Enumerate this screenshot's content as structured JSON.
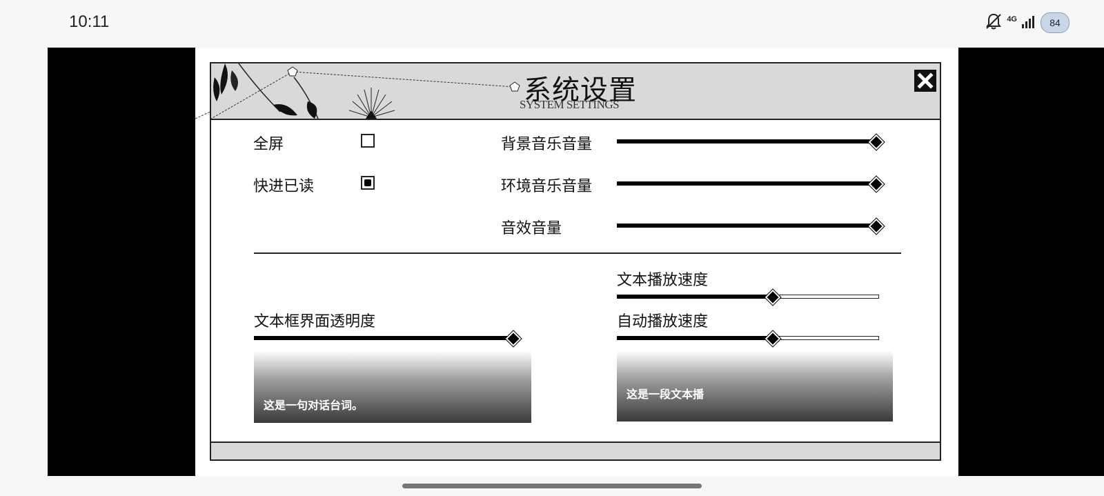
{
  "status_bar": {
    "time": "10:11",
    "network": "4G",
    "battery": "84",
    "icons": [
      "bell-muted-icon",
      "signal-icon",
      "battery-icon"
    ]
  },
  "dialog": {
    "title_zh": "系统设置",
    "title_en": "SYSTEM SETTINGS",
    "close_icon": "close-icon",
    "fullscreen": {
      "label": "全屏",
      "checked": false
    },
    "skip_read": {
      "label": "快进已读",
      "checked": true
    },
    "bgm_volume": {
      "label": "背景音乐音量",
      "value": 1.0
    },
    "ambient_volume": {
      "label": "环境音乐音量",
      "value": 1.0
    },
    "sfx_volume": {
      "label": "音效音量",
      "value": 1.0
    },
    "text_box_opacity": {
      "label": "文本框界面透明度",
      "value": 1.0
    },
    "text_speed": {
      "label": "文本播放速度",
      "value": 0.6
    },
    "auto_speed": {
      "label": "自动播放速度",
      "value": 0.6
    },
    "dialogue_preview": "这是一句对话台词。",
    "text_preview": "这是一段文本播"
  },
  "colors": {
    "header_bg": "#d9d9d9",
    "letterbox": "#000000",
    "panel_bg": "#ffffff"
  }
}
